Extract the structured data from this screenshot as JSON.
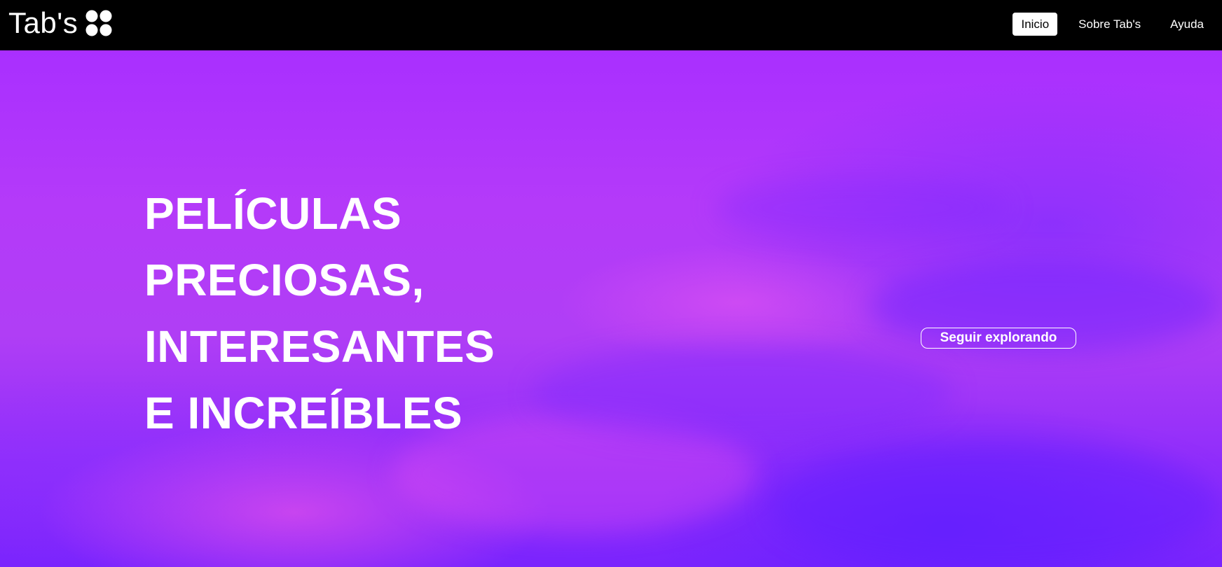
{
  "header": {
    "brand_name": "Tab's",
    "logo_icon": "four-circles-logo-icon",
    "nav": [
      {
        "label": "Inicio",
        "active": true
      },
      {
        "label": "Sobre Tab's",
        "active": false
      },
      {
        "label": "Ayuda",
        "active": false
      }
    ]
  },
  "hero": {
    "headline_lines": [
      "PELÍCULAS",
      "PRECIOSAS,",
      "INTERESANTES",
      "E INCREÍBLES"
    ],
    "cta_label": "Seguir explorando"
  },
  "colors": {
    "header_bg": "#000000",
    "hero_purple": "#b03ef5",
    "hero_violet": "#7a24fd",
    "hero_pink": "#f04fe8",
    "text": "#ffffff"
  }
}
